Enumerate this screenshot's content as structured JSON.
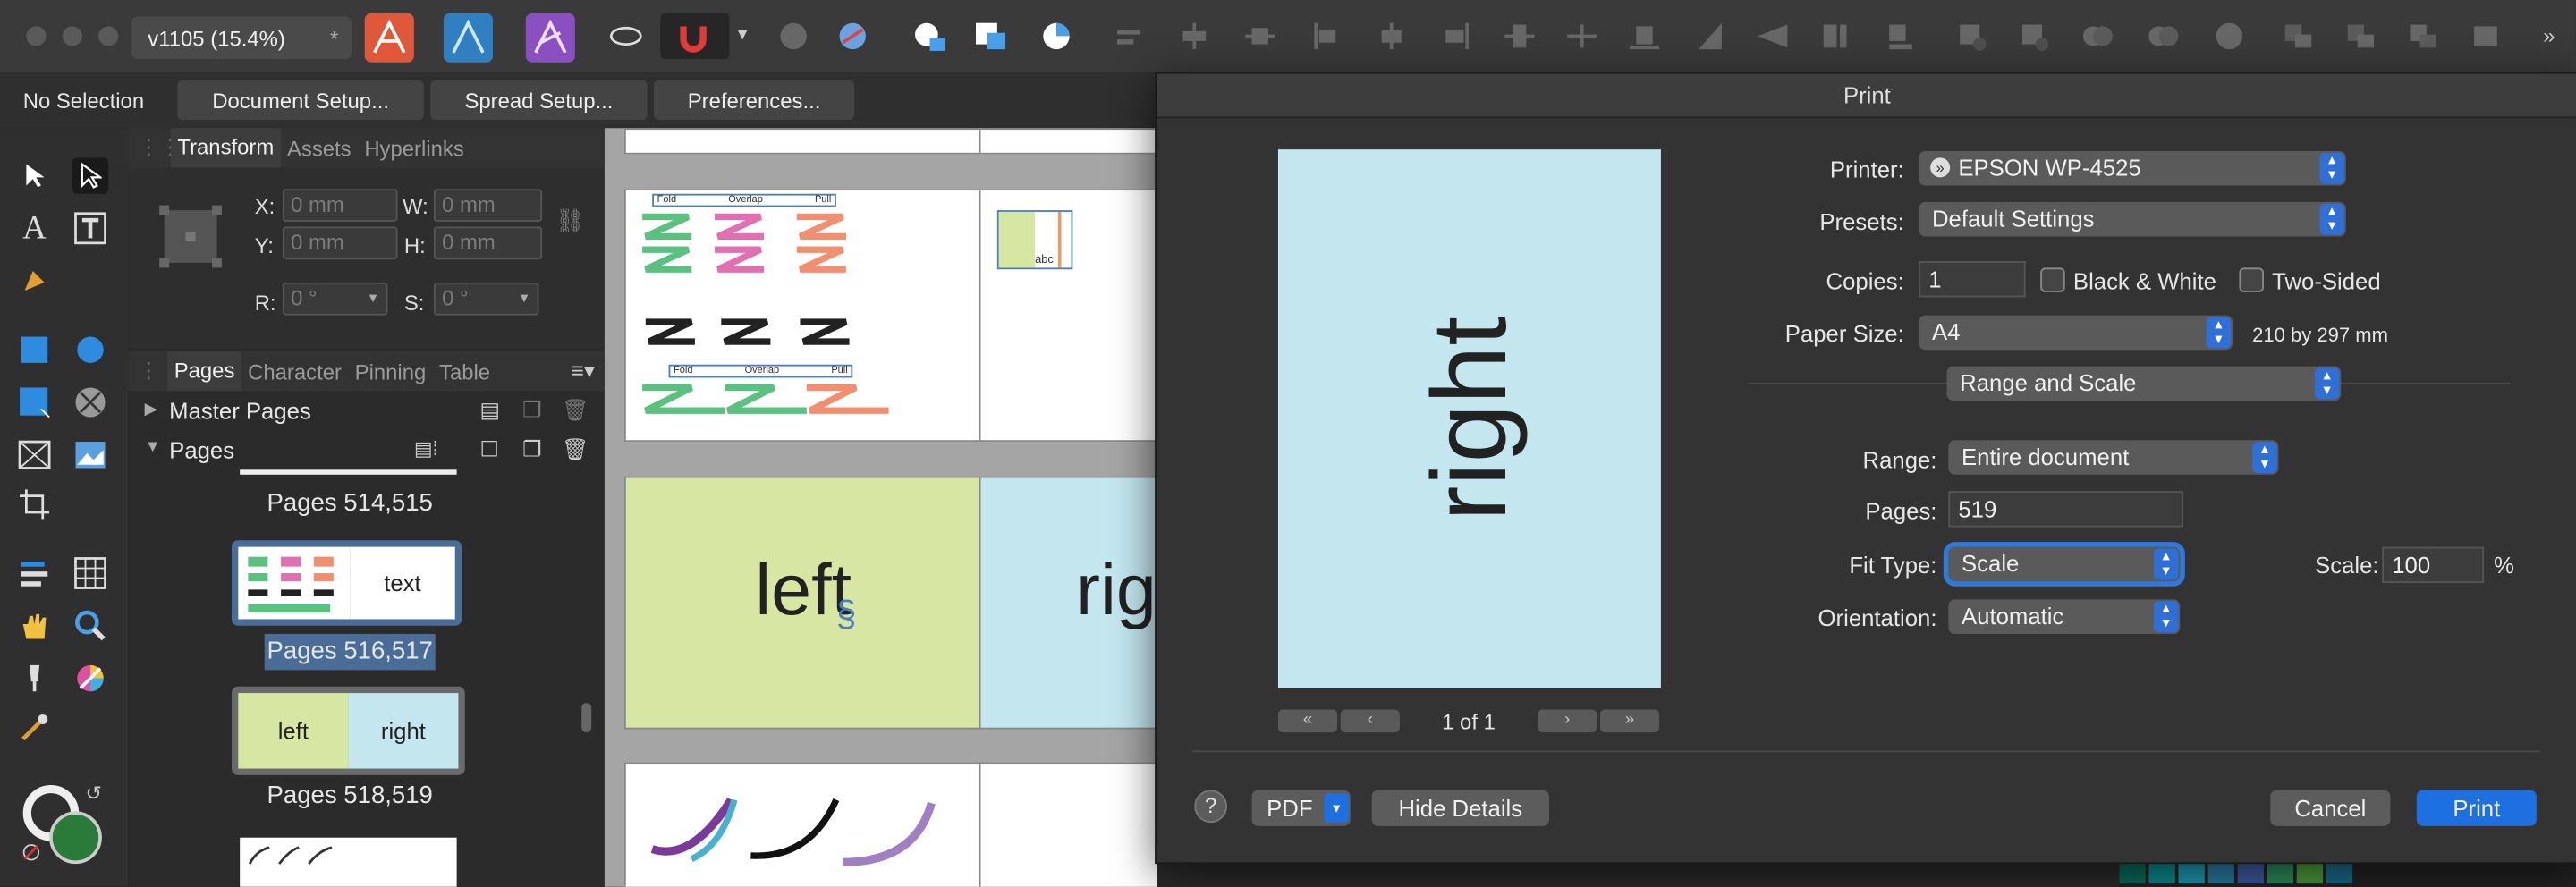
{
  "toolbar": {
    "doc_title": "v1105  (15.4%)",
    "modified_marker": "*"
  },
  "context_bar": {
    "selection": "No Selection",
    "document_setup": "Document Setup...",
    "spread_setup": "Spread Setup...",
    "preferences": "Preferences..."
  },
  "transform_panel": {
    "tabs": [
      "Transform",
      "Assets",
      "Hyperlinks"
    ],
    "x_label": "X:",
    "x_value": "0 mm",
    "y_label": "Y:",
    "y_value": "0 mm",
    "w_label": "W:",
    "w_value": "0 mm",
    "h_label": "H:",
    "h_value": "0 mm",
    "r_label": "R:",
    "r_value": "0 °",
    "s_label": "S:",
    "s_value": "0 °"
  },
  "pages_panel": {
    "tabs": [
      "Pages",
      "Character",
      "Pinning",
      "Table"
    ],
    "master_pages": "Master Pages",
    "pages": "Pages",
    "spread_1": "Pages 514,515",
    "spread_2": "Pages 516,517",
    "spread_2_thumb_text": "text",
    "spread_3": "Pages 518,519",
    "thumb_left": "left",
    "thumb_right": "right"
  },
  "canvas": {
    "fold": "Fold",
    "overlap": "Overlap",
    "pull": "Pull",
    "abc": "abc",
    "left_text": "left",
    "right_text": "rig"
  },
  "print_dialog": {
    "title": "Print",
    "preview_text": "right",
    "page_counter": "1 of 1",
    "printer_label": "Printer:",
    "printer_value": "EPSON WP-4525",
    "presets_label": "Presets:",
    "presets_value": "Default Settings",
    "copies_label": "Copies:",
    "copies_value": "1",
    "bw_label": "Black & White",
    "two_sided_label": "Two-Sided",
    "paper_size_label": "Paper Size:",
    "paper_size_value": "A4",
    "paper_dims": "210 by 297 mm",
    "section_value": "Range and Scale",
    "range_label": "Range:",
    "range_value": "Entire document",
    "pages_label": "Pages:",
    "pages_value": "519",
    "fit_type_label": "Fit Type:",
    "fit_type_value": "Scale",
    "scale_label": "Scale:",
    "scale_value": "100",
    "percent": "%",
    "orientation_label": "Orientation:",
    "orientation_value": "Automatic",
    "help": "?",
    "pdf": "PDF",
    "hide_details": "Hide Details",
    "cancel": "Cancel",
    "print": "Print"
  },
  "colors": {
    "accent": "#1e6fe0",
    "preview_page": "#c3e6ef",
    "left_page": "#d8e6a4",
    "right_page": "#c3e6ef",
    "fill_swatch": "#2a7a3a"
  }
}
